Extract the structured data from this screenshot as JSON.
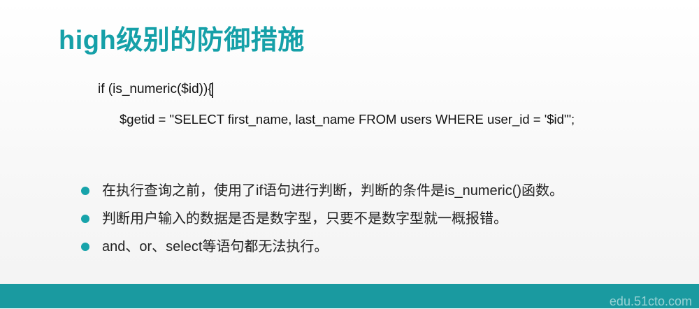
{
  "slide": {
    "title": "high级别的防御措施",
    "code_lines": [
      "if (is_numeric($id)){",
      "$getid = \"SELECT first_name, last_name FROM users WHERE user_id = '$id'\";"
    ],
    "bullets": [
      "在执行查询之前，使用了if语句进行判断，判断的条件是is_numeric()函数。",
      "判断用户输入的数据是否是数字型，只要不是数字型就一概报错。",
      "and、or、select等语句都无法执行。"
    ]
  },
  "footer": {
    "watermark": "edu.51cto.com"
  },
  "colors": {
    "accent": "#15a0a8",
    "footer_bar": "#1a9aa0",
    "bullet": "#17a3aa"
  }
}
